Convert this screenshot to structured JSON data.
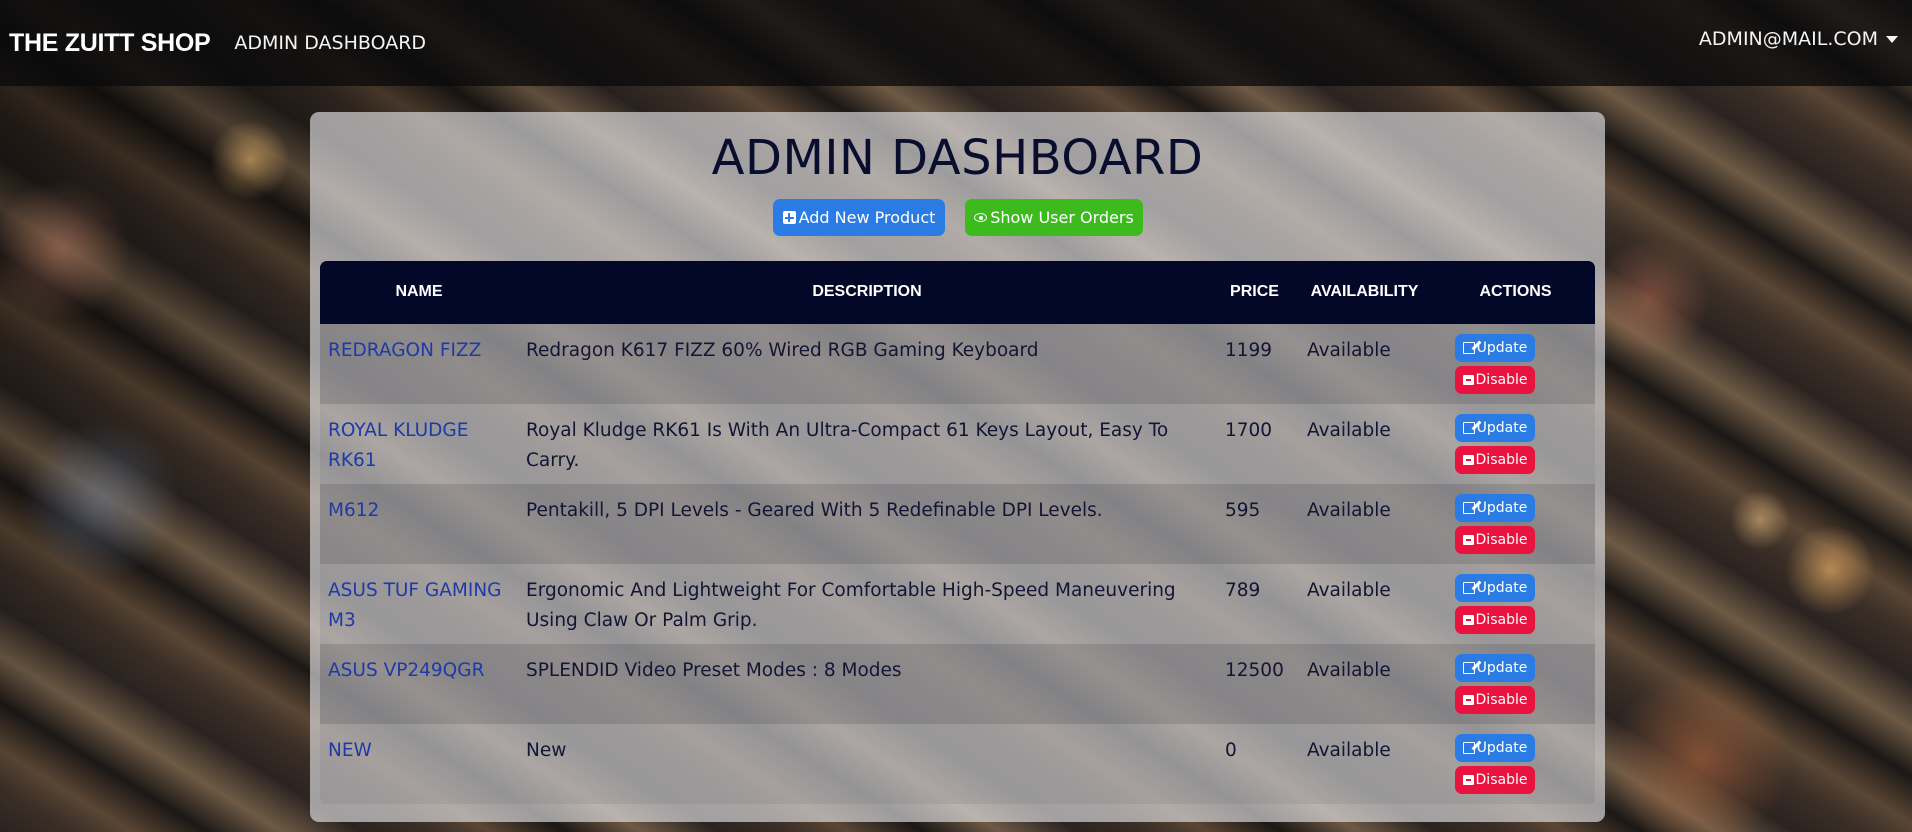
{
  "navbar": {
    "brand": "THE ZUITT SHOP",
    "link": "ADMIN DASHBOARD",
    "user": "ADMIN@MAIL.COM"
  },
  "page": {
    "title": "ADMIN DASHBOARD",
    "add_button": "Add New Product",
    "orders_button": "Show User Orders"
  },
  "table": {
    "headers": {
      "name": "NAME",
      "description": "DESCRIPTION",
      "price": "PRICE",
      "availability": "AVAILABILITY",
      "actions": "ACTIONS"
    },
    "update_label": "Update",
    "disable_label": "Disable",
    "rows": [
      {
        "name": "REDRAGON FIZZ",
        "description": "Redragon K617 FIZZ 60% Wired RGB Gaming Keyboard",
        "price": "1199",
        "availability": "Available"
      },
      {
        "name": "ROYAL KLUDGE RK61",
        "description": "Royal Kludge RK61 Is With An Ultra-Compact 61 Keys Layout, Easy To Carry.",
        "price": "1700",
        "availability": "Available"
      },
      {
        "name": "M612",
        "description": "Pentakill, 5 DPI Levels - Geared With 5 Redefinable DPI Levels.",
        "price": "595",
        "availability": "Available"
      },
      {
        "name": "ASUS TUF GAMING M3",
        "description": "Ergonomic And Lightweight For Comfortable High-Speed Maneuvering Using Claw Or Palm Grip.",
        "price": "789",
        "availability": "Available"
      },
      {
        "name": "ASUS VP249QGR",
        "description": "SPLENDID Video Preset Modes : 8 Modes",
        "price": "12500",
        "availability": "Available"
      },
      {
        "name": "NEW",
        "description": "New",
        "price": "0",
        "availability": "Available"
      }
    ]
  },
  "colors": {
    "navbar": "#0a0a0c",
    "table_header": "#030829",
    "update_button": "#2a7be4",
    "disable_button": "#e8133f",
    "orders_button": "#3dba1e",
    "product_name": "#1e3aa8"
  }
}
